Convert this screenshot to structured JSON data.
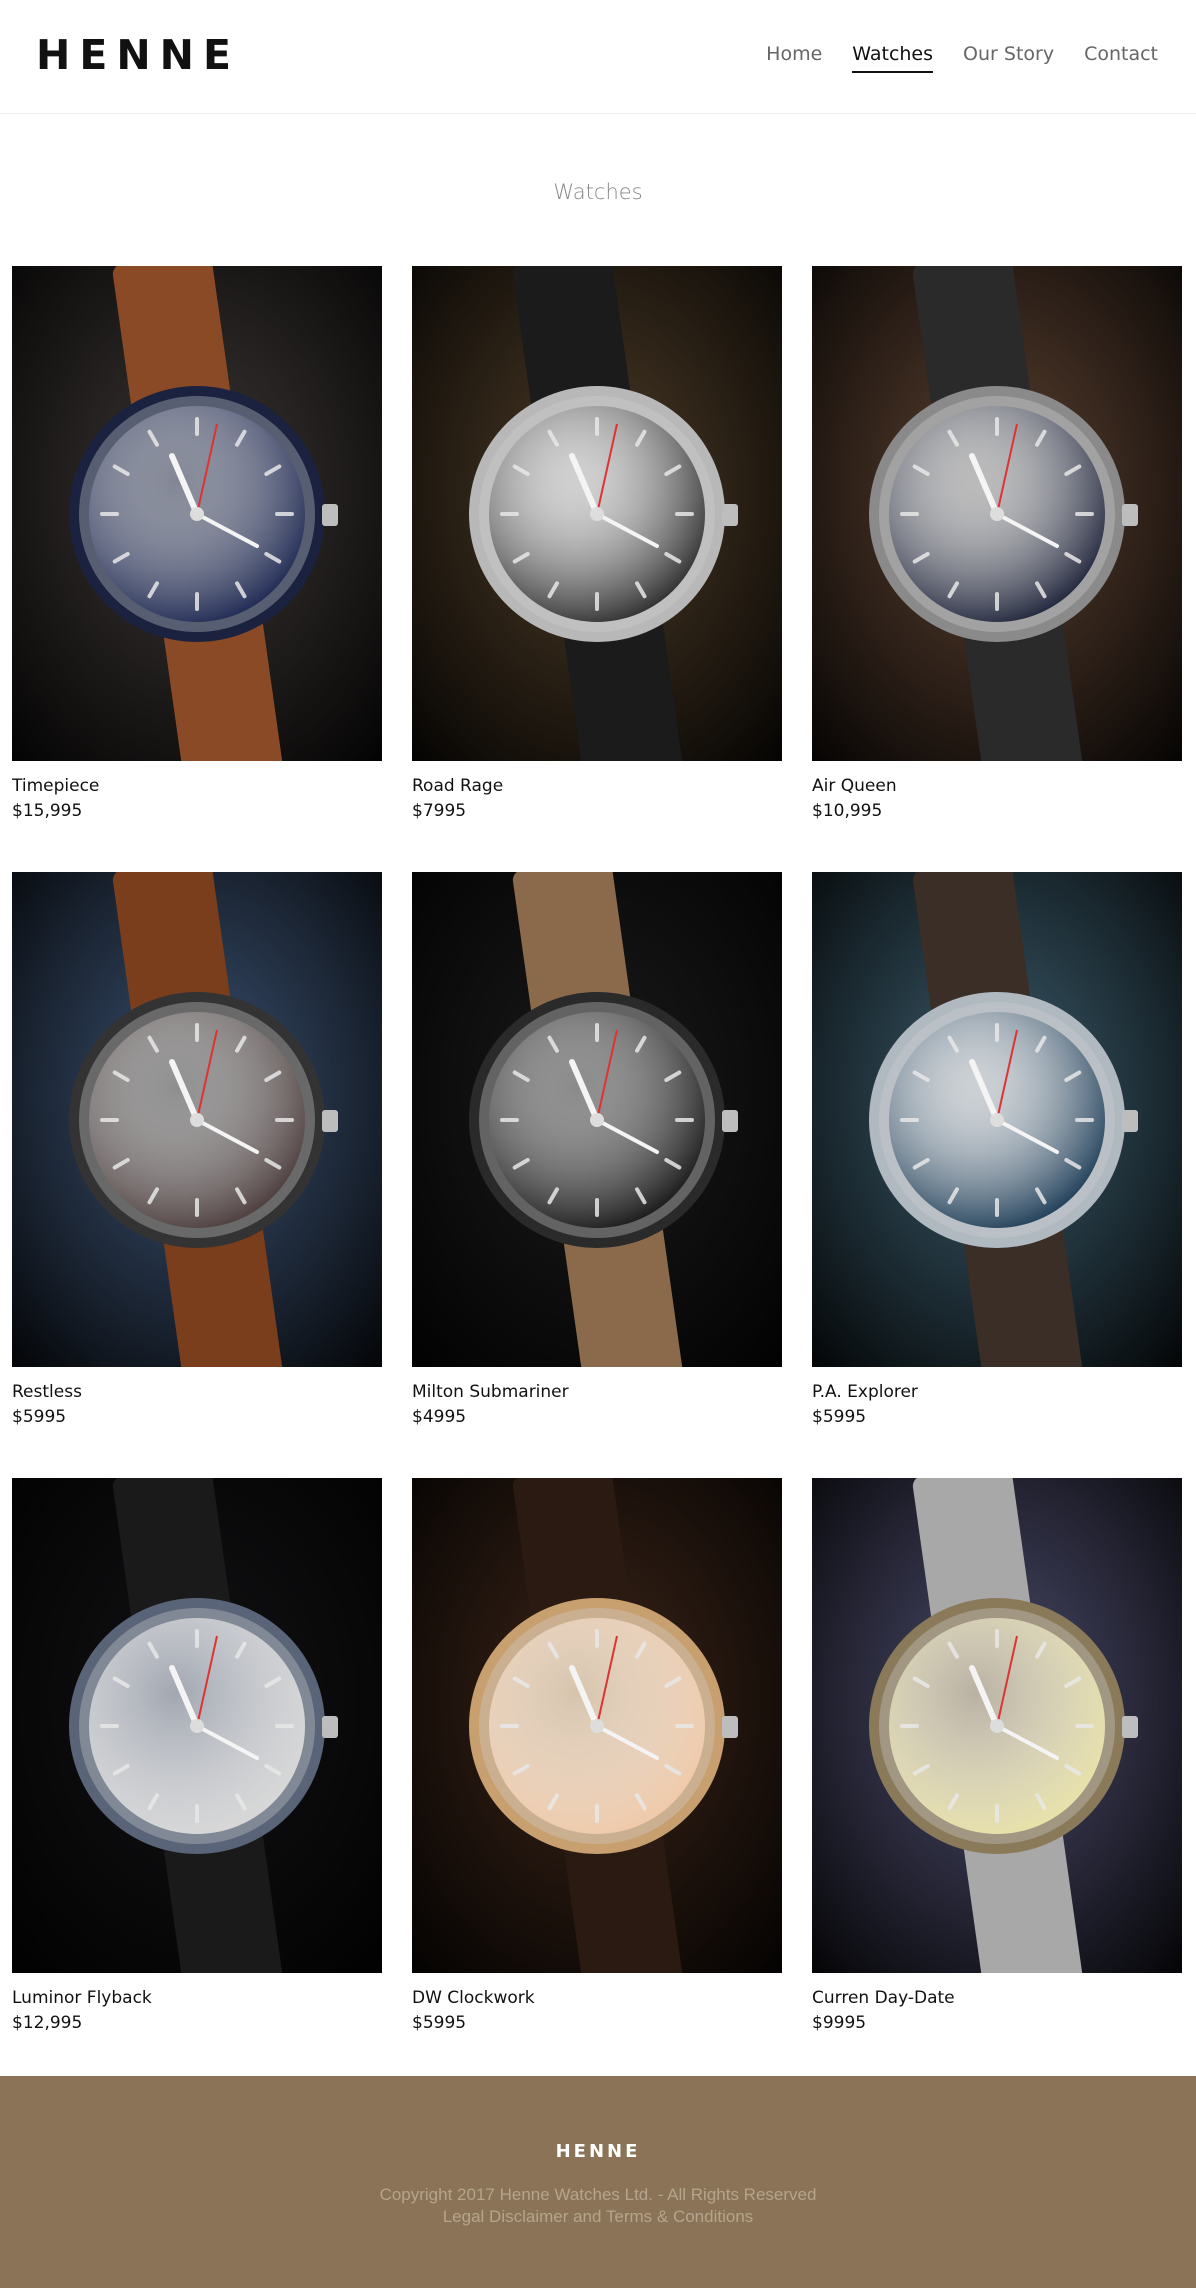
{
  "brand": {
    "logo": "HENNE"
  },
  "nav": {
    "items": [
      {
        "label": "Home",
        "active": false
      },
      {
        "label": "Watches",
        "active": true
      },
      {
        "label": "Our Story",
        "active": false
      },
      {
        "label": "Contact",
        "active": false
      }
    ]
  },
  "main": {
    "title": "Watches",
    "products": [
      {
        "name": "Timepiece",
        "price": "$15,995",
        "image": "navy-dive-watch-brown-strap",
        "bg": "#3a3533",
        "dial": "#1b2550",
        "strap": "#8a4a25",
        "bezel": "#1a2240"
      },
      {
        "name": "Road Rage",
        "price": "$7995",
        "image": "chronograph-wood-table",
        "bg": "#4b3a26",
        "dial": "#2a2a2a",
        "strap": "#1b1b1b",
        "bezel": "#b8b8b8"
      },
      {
        "name": "Air Queen",
        "price": "$10,995",
        "image": "pilot-watch-leather",
        "bg": "#5a4030",
        "dial": "#1b2138",
        "strap": "#2a2a2a",
        "bezel": "#8a8a8a"
      },
      {
        "name": "Restless",
        "price": "$5995",
        "image": "dive-watch-denim",
        "bg": "#3a5070",
        "dial": "#4a3a3a",
        "strap": "#7a3e1c",
        "bezel": "#333333"
      },
      {
        "name": "Milton Submariner",
        "price": "$4995",
        "image": "black-watch-typewriter",
        "bg": "#1a1a1a",
        "dial": "#151515",
        "strap": "#8a6a4a",
        "bezel": "#2a2a2a"
      },
      {
        "name": "P.A. Explorer",
        "price": "$5995",
        "image": "panerai-blue-dial",
        "bg": "#3a5a6a",
        "dial": "#1a3a55",
        "strap": "#3a2e26",
        "bezel": "#b0b8c0"
      },
      {
        "name": "Luminor Flyback",
        "price": "$12,995",
        "image": "perpetual-calendar-wrist",
        "bg": "#121214",
        "dial": "#d8d8d8",
        "strap": "#1a1a1a",
        "bezel": "#5a6478"
      },
      {
        "name": "DW Clockwork",
        "price": "$5995",
        "image": "minimal-rose-dial-warm-light",
        "bg": "#3a2418",
        "dial": "#f0c9a8",
        "strap": "#2a1a12",
        "bezel": "#c8a070"
      },
      {
        "name": "Curren Day-Date",
        "price": "$9995",
        "image": "steel-bracelet-yellow-dial",
        "bg": "#4a4a6a",
        "dial": "#e8e2a8",
        "strap": "#a8a8a8",
        "bezel": "#8a7a5a"
      }
    ]
  },
  "footer": {
    "logo": "HENNE",
    "copyright": "Copyright 2017 Henne Watches Ltd. - All Rights Reserved",
    "legal": "Legal Disclaimer and Terms & Conditions",
    "bg_color": "#8a7356"
  }
}
